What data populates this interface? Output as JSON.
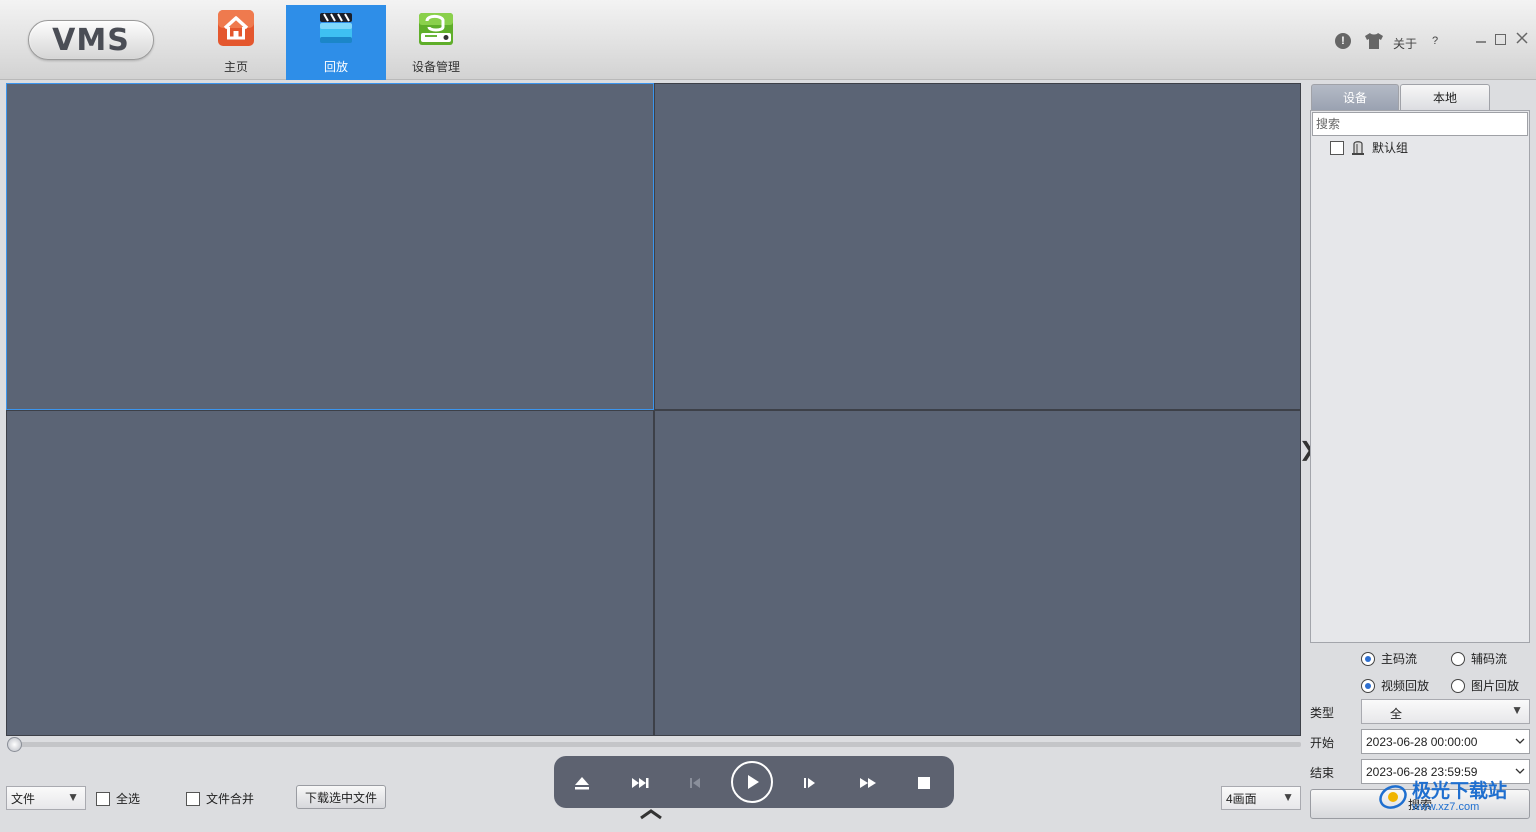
{
  "app": {
    "logo_text": "VMS"
  },
  "nav": {
    "tabs": [
      {
        "label": "主页",
        "icon": "home-icon",
        "active": false
      },
      {
        "label": "回放",
        "icon": "clapperboard-icon",
        "active": true
      },
      {
        "label": "设备管理",
        "icon": "device-manager-icon",
        "active": false
      }
    ]
  },
  "titlebar": {
    "about_label": "关于",
    "help_label": "?",
    "info_label": "!"
  },
  "video": {
    "pane_count": 4,
    "selected_pane": 1
  },
  "timeline": {
    "position": 0
  },
  "bottom": {
    "file_select_value": "文件",
    "select_all_label": "全选",
    "merge_files_label": "文件合并",
    "download_button_label": "下载选中文件",
    "layout_select_value": "4画面"
  },
  "player_controls": [
    "eject-icon",
    "skip-end-icon",
    "step-back-icon",
    "play-icon",
    "step-forward-icon",
    "fast-forward-icon",
    "stop-icon"
  ],
  "right_panel": {
    "tabs": [
      {
        "label": "设备",
        "active": true
      },
      {
        "label": "本地",
        "active": false
      }
    ],
    "search_placeholder": "搜索",
    "tree": [
      {
        "label": "默认组",
        "checked": false
      }
    ],
    "stream": {
      "main_label": "主码流",
      "sub_label": "辅码流",
      "selected": "主码流"
    },
    "mode": {
      "video_label": "视频回放",
      "picture_label": "图片回放",
      "selected": "视频回放"
    },
    "type_label": "类型",
    "type_value": "全",
    "start_label": "开始",
    "start_value": "2023-06-28 00:00:00",
    "end_label": "结束",
    "end_value": "2023-06-28 23:59:59",
    "search_button_label": "搜索"
  },
  "watermark": {
    "text": "极光下载站",
    "url": "www.xz7.com"
  },
  "colors": {
    "accent": "#2e8ee8",
    "video_pane": "#5b6475",
    "selected_pane_border": "#3b95ee",
    "player_bar": "#5d6270"
  }
}
